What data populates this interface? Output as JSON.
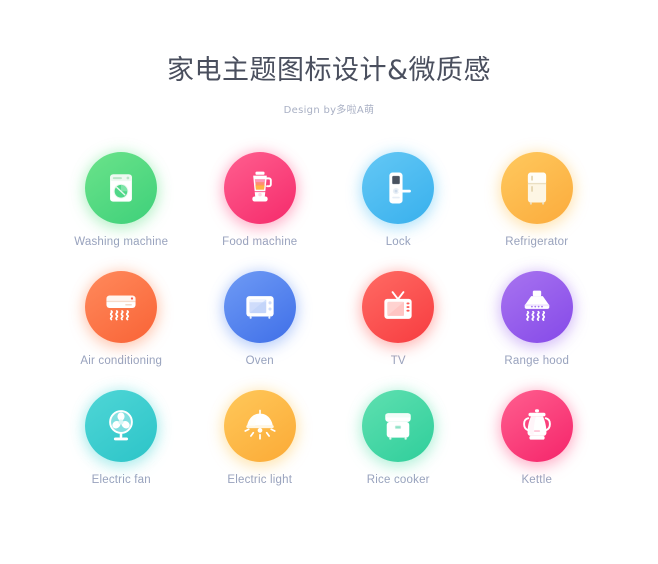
{
  "header": {
    "title": "家电主题图标设计&微质感",
    "subtitle": "Design by多啦A萌",
    "title_color": "#4a4f5e",
    "subtitle_color": "#a9b0c4"
  },
  "theme": {
    "background": "#ffffff",
    "label_color": "#98a2bd"
  },
  "icons": [
    {
      "label": "Washing machine",
      "icon": "washing-machine-icon",
      "color_from": "#6be38a",
      "color_to": "#3ed07a",
      "glow": "#7ae79a"
    },
    {
      "label": "Food machine",
      "icon": "blender-icon",
      "color_from": "#ff5f8f",
      "color_to": "#f52a6b",
      "glow": "#ff6d9c"
    },
    {
      "label": "Lock",
      "icon": "door-lock-icon",
      "color_from": "#64c8f5",
      "color_to": "#38b0ed",
      "glow": "#74cdf7"
    },
    {
      "label": "Refrigerator",
      "icon": "refrigerator-icon",
      "color_from": "#ffc95e",
      "color_to": "#fbab3c",
      "glow": "#ffcf72"
    },
    {
      "label": "Air conditioning",
      "icon": "air-conditioner-icon",
      "color_from": "#ff8a5c",
      "color_to": "#f96336",
      "glow": "#ff9a70"
    },
    {
      "label": "Oven",
      "icon": "oven-icon",
      "color_from": "#6f9bf5",
      "color_to": "#3f6fe8",
      "glow": "#7ea6f7"
    },
    {
      "label": "TV",
      "icon": "tv-icon",
      "color_from": "#ff6b64",
      "color_to": "#f73c40",
      "glow": "#ff7b75"
    },
    {
      "label": "Range hood",
      "icon": "range-hood-icon",
      "color_from": "#a874f0",
      "color_to": "#8549e8",
      "glow": "#b286f3"
    },
    {
      "label": "Electric fan",
      "icon": "electric-fan-icon",
      "color_from": "#4fd6d6",
      "color_to": "#2cc4c8",
      "glow": "#62dcdc"
    },
    {
      "label": "Electric light",
      "icon": "pendant-lamp-icon",
      "color_from": "#ffc85a",
      "color_to": "#fbaa36",
      "glow": "#ffd06e"
    },
    {
      "label": "Rice cooker",
      "icon": "rice-cooker-icon",
      "color_from": "#5fe0b0",
      "color_to": "#2fce9b",
      "glow": "#72e5ba"
    },
    {
      "label": "Kettle",
      "icon": "kettle-icon",
      "color_from": "#ff5f8f",
      "color_to": "#f5246a",
      "glow": "#ff6f9b"
    }
  ]
}
